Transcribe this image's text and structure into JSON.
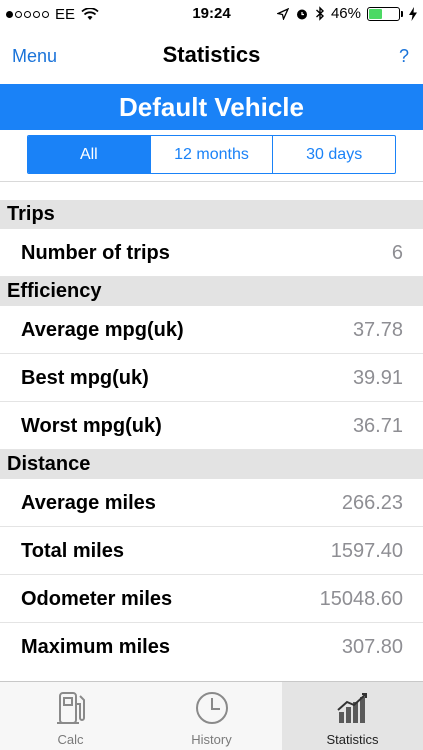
{
  "status": {
    "carrier": "EE",
    "time": "19:24",
    "battery": "46%",
    "battery_level": 0.46,
    "signal_filled": 1,
    "signal_total": 5
  },
  "nav": {
    "menu_label": "Menu",
    "title": "Statistics",
    "help_label": "?"
  },
  "vehicle": {
    "name": "Default Vehicle"
  },
  "periods": [
    {
      "label": "All",
      "selected": true
    },
    {
      "label": "12 months",
      "selected": false
    },
    {
      "label": "30 days",
      "selected": false
    }
  ],
  "sections": [
    {
      "title": "Trips",
      "rows": [
        {
          "label": "Number of trips",
          "value": "6"
        }
      ]
    },
    {
      "title": "Efficiency",
      "rows": [
        {
          "label": "Average mpg(uk)",
          "value": "37.78"
        },
        {
          "label": "Best mpg(uk)",
          "value": "39.91"
        },
        {
          "label": "Worst mpg(uk)",
          "value": "36.71"
        }
      ]
    },
    {
      "title": "Distance",
      "rows": [
        {
          "label": "Average miles",
          "value": "266.23"
        },
        {
          "label": "Total miles",
          "value": "1597.40"
        },
        {
          "label": "Odometer miles",
          "value": "15048.60"
        },
        {
          "label": "Maximum miles",
          "value": "307.80"
        }
      ]
    }
  ],
  "tabs": [
    {
      "label": "Calc",
      "icon": "fuel-pump-icon",
      "active": false
    },
    {
      "label": "History",
      "icon": "clock-icon",
      "active": false
    },
    {
      "label": "Statistics",
      "icon": "chart-icon",
      "active": true
    }
  ],
  "colors": {
    "accent": "#1a82f7",
    "link": "#1a73d9",
    "section_bg": "#e3e3e3",
    "battery_fill": "#4cd964"
  }
}
